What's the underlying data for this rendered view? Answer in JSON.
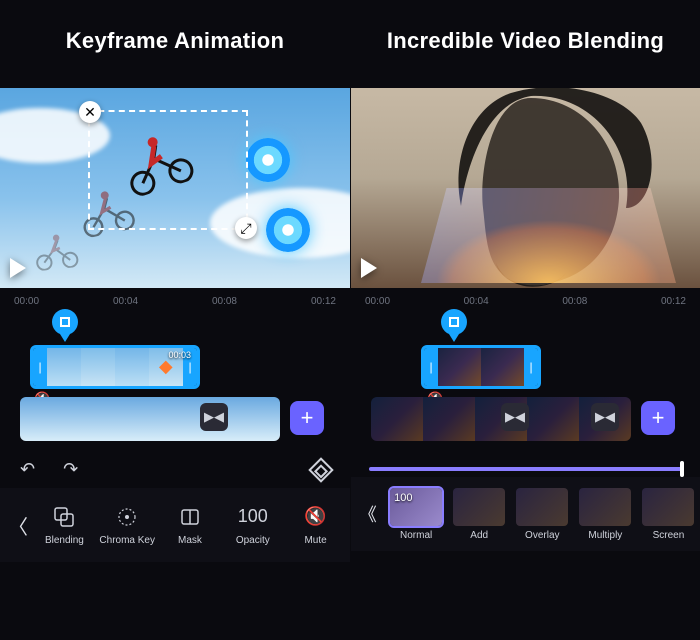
{
  "left": {
    "headline": "Keyframe Animation",
    "ruler": [
      "00:00",
      "00:04",
      "00:08",
      "00:12"
    ],
    "clip1_duration": "00:03",
    "toolbar": {
      "blending": "Blending",
      "chroma": "Chroma Key",
      "mask": "Mask",
      "opacity_label": "Opacity",
      "opacity_value": "100",
      "mute": "Mute"
    }
  },
  "right": {
    "headline": "Incredible Video Blending",
    "ruler": [
      "00:00",
      "00:04",
      "00:08",
      "00:12"
    ],
    "opacity_value": "100",
    "modes": {
      "normal": "Normal",
      "add": "Add",
      "overlay": "Overlay",
      "multiply": "Multiply",
      "screen": "Screen"
    }
  },
  "icons": {
    "close": "✕",
    "resize": "⤢",
    "play": "▶",
    "undo": "↶",
    "redo": "↷",
    "back": "〈",
    "back2": "《",
    "plus": "+",
    "mute": "🔇",
    "trans": "▶◀",
    "grip_l": "|",
    "grip_r": "|"
  }
}
